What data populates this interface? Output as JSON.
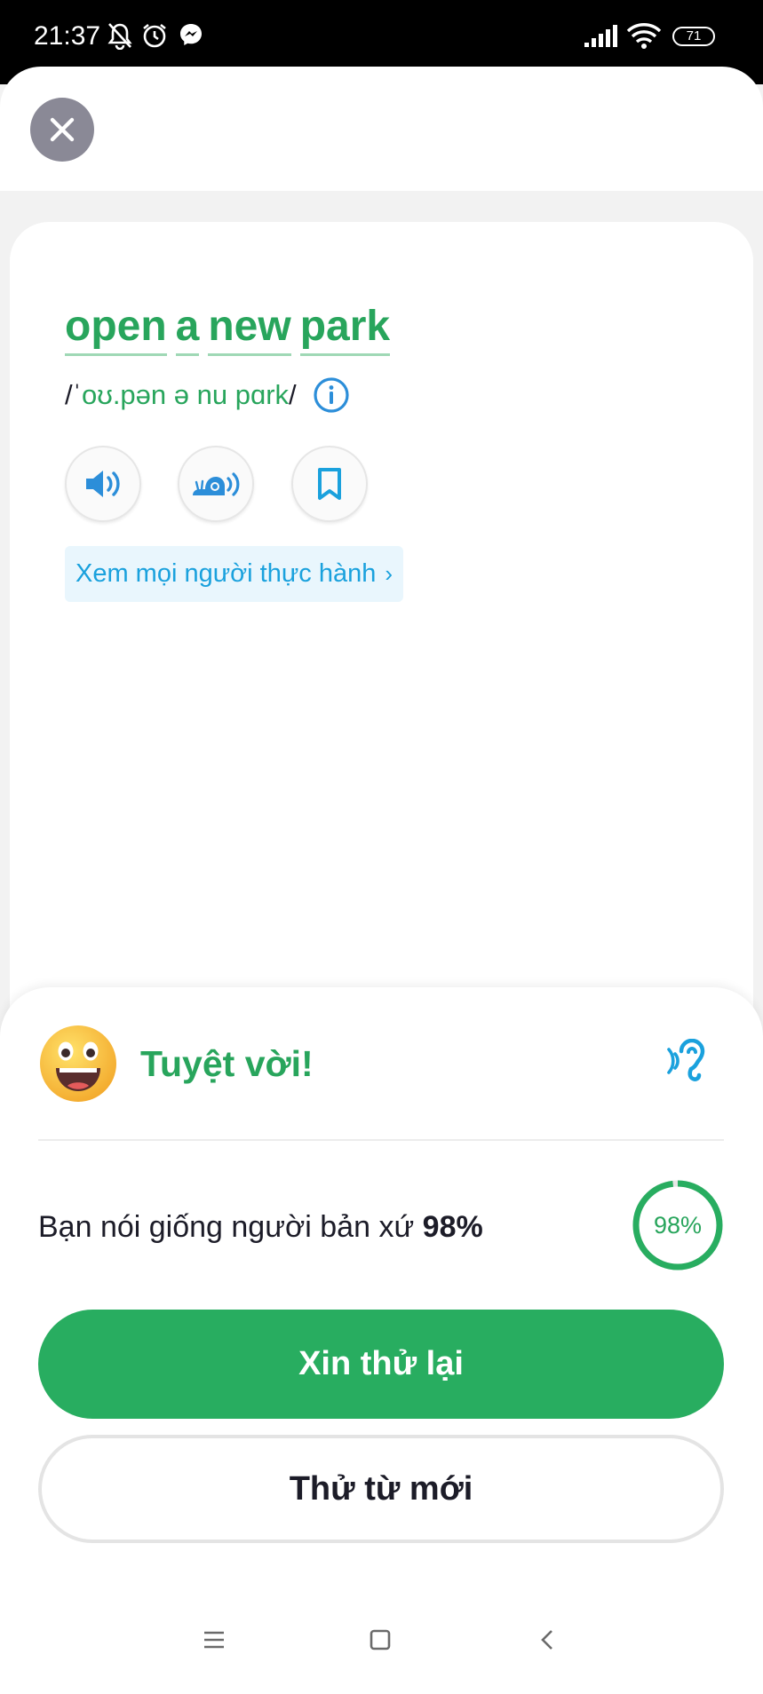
{
  "status_bar": {
    "time": "21:37",
    "battery": "71",
    "icons": [
      "bell-off-icon",
      "alarm-icon",
      "messenger-icon",
      "signal-icon",
      "wifi-icon",
      "battery-icon"
    ]
  },
  "header": {
    "close_icon": "close-icon"
  },
  "word_card": {
    "phrase_words": [
      "open",
      "a",
      "new",
      "park"
    ],
    "ipa_open": "/",
    "ipa_stress": "ˈ",
    "ipa_body": "oʊ.pən ə nu pɑrk",
    "ipa_close": "/",
    "info_icon": "info-icon",
    "buttons": [
      "speaker-icon",
      "slow-snail-icon",
      "bookmark-icon"
    ],
    "see_others_label": "Xem mọi người thực hành",
    "see_others_chevron": "›"
  },
  "result": {
    "title": "Tuyệt vời!",
    "score_prefix": "Bạn nói giống người bản xứ",
    "score_value": "98%",
    "score_percent": 98,
    "ring_label": "98%",
    "retry_label": "Xin thử lại",
    "new_word_label": "Thử từ mới"
  },
  "colors": {
    "accent_green": "#28a55c",
    "button_green": "#28ad60",
    "link_blue": "#1aa1dd",
    "icon_blue": "#2c8ed9"
  },
  "nav_bar": {
    "icons": [
      "menu-icon",
      "home-square-icon",
      "back-icon"
    ]
  }
}
